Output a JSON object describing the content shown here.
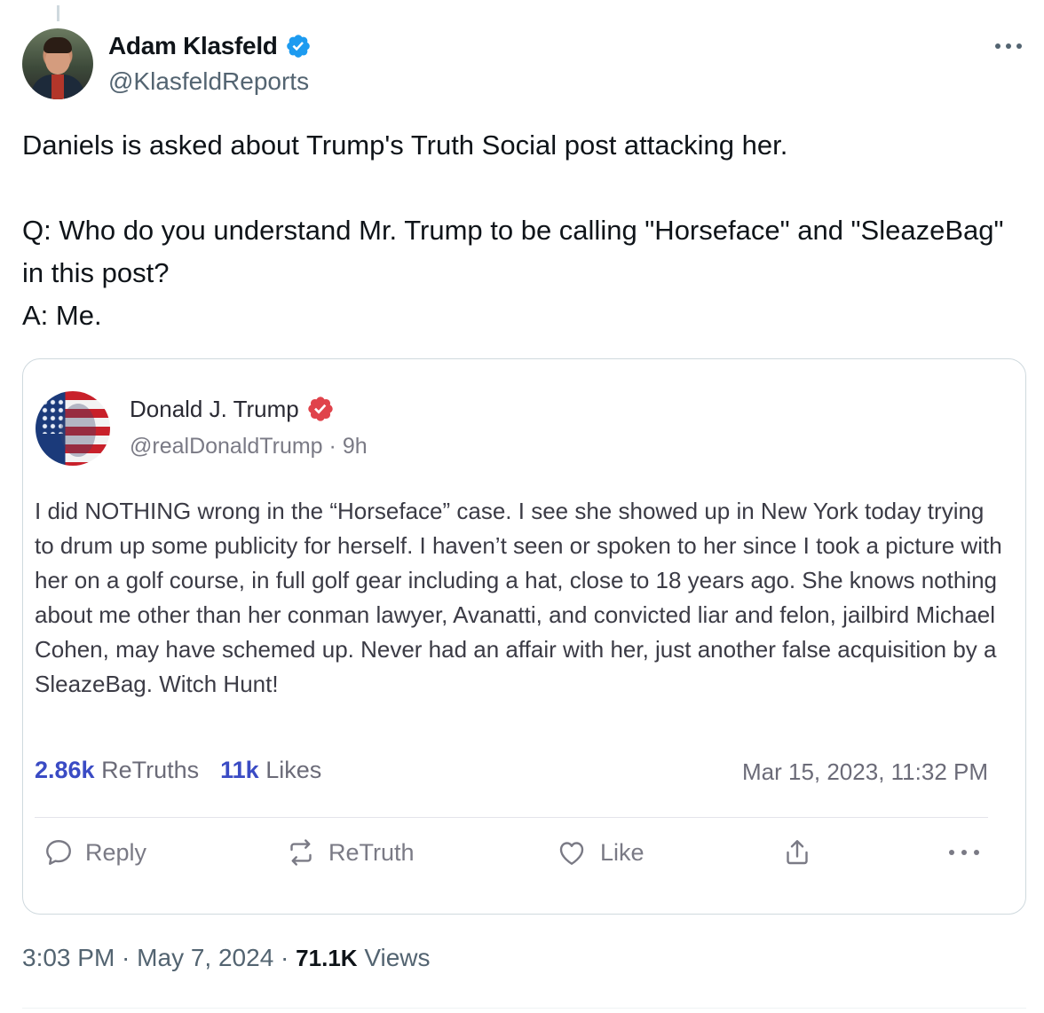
{
  "author": {
    "display_name": "Adam Klasfeld",
    "handle": "@KlasfeldReports",
    "verified_icon": "verified-badge-icon"
  },
  "tweet": {
    "paragraph1": "Daniels is asked about Trump's Truth Social post attacking her.",
    "paragraph2": "Q: Who do you understand Mr. Trump to be calling \"Horseface\" and \"SleazeBag\" in this post?\nA: Me."
  },
  "quoted": {
    "display_name": "Donald J. Trump",
    "handle": "@realDonaldTrump",
    "time_ago": "· 9h",
    "body": "I did NOTHING wrong in the “Horseface” case. I see she showed up in New York today trying to drum up some publicity for herself. I haven’t seen or spoken to her since I took a picture with her on a golf course, in full golf gear including a hat, close to 18 years ago. She knows nothing about me other than her conman lawyer, Avanatti, and convicted liar and felon, jailbird Michael Cohen, may have schemed up. Never had an affair with her, just another false acquisition by a SleazeBag. Witch Hunt!",
    "retruths_count": "2.86k",
    "retruths_label": "ReTruths",
    "likes_count": "11k",
    "likes_label": "Likes",
    "date": "Mar 15, 2023, 11:32 PM",
    "actions": {
      "reply": "Reply",
      "retruth": "ReTruth",
      "like": "Like"
    }
  },
  "footer": {
    "time": "3:03 PM",
    "separator1": " · ",
    "date": "May 7, 2024",
    "separator2": " · ",
    "views_count": "71.1K",
    "views_label": " Views"
  },
  "colors": {
    "verified_blue": "#1d9bf0",
    "truth_badge_red": "#e0434b",
    "truth_link_blue": "#3a4bc4"
  }
}
